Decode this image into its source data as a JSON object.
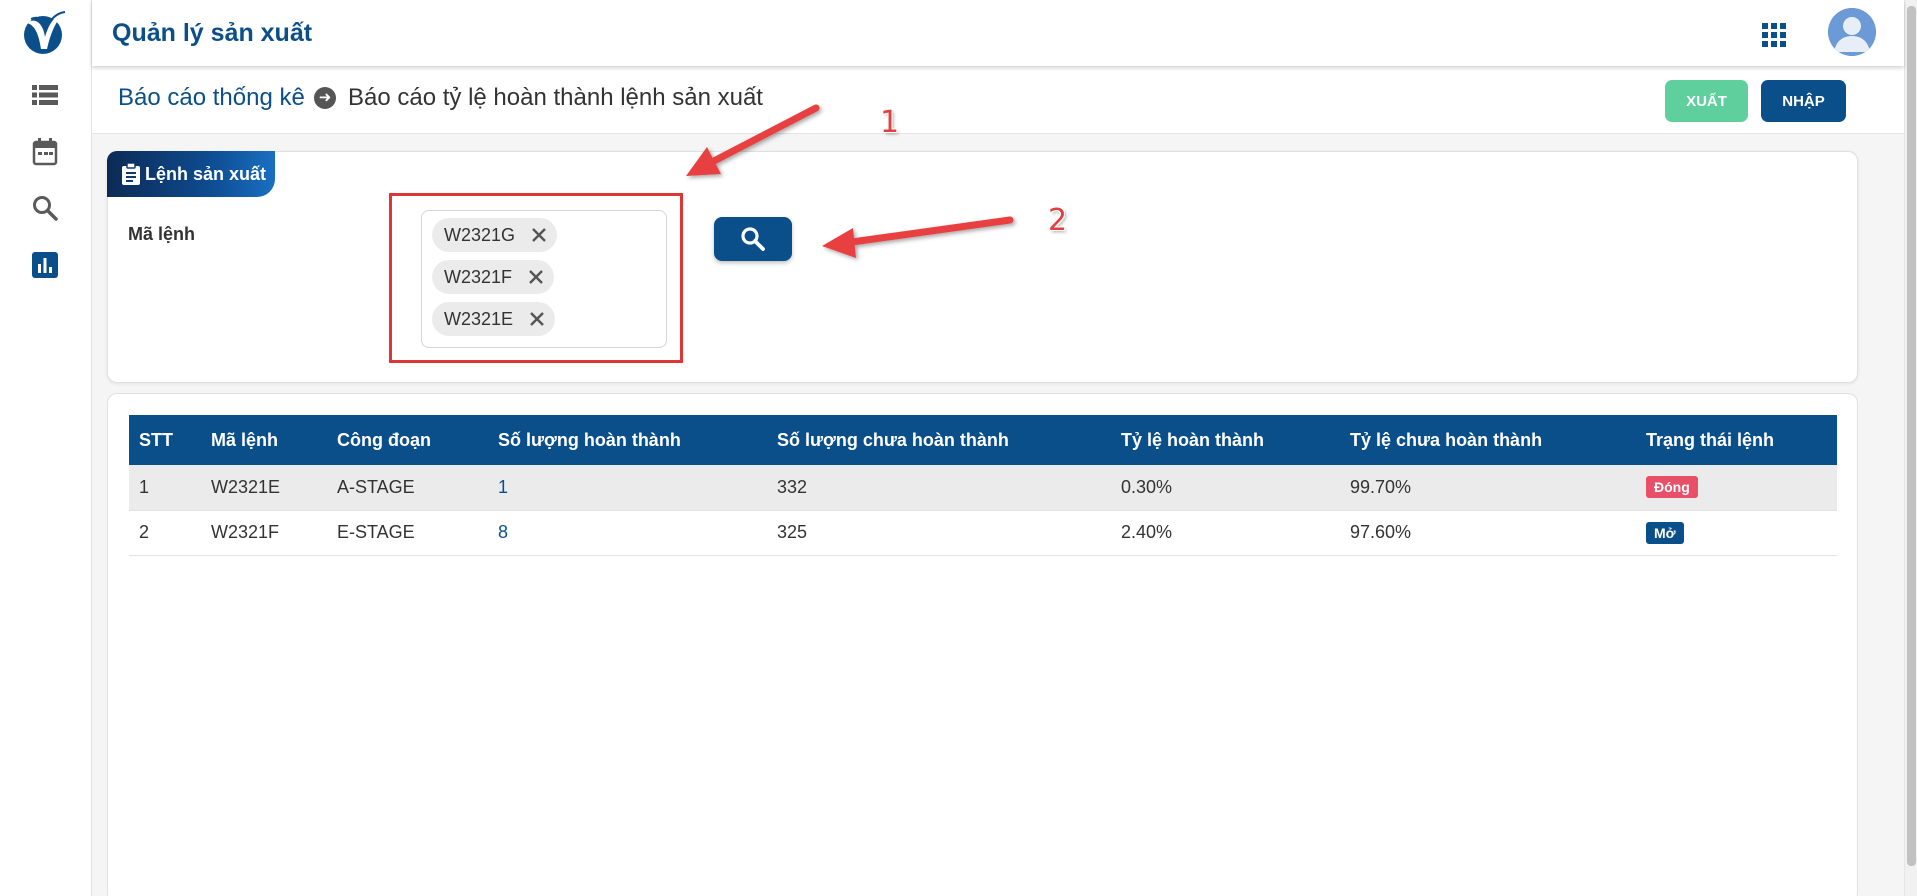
{
  "app": {
    "title": "Quản lý sản xuất"
  },
  "sidebar": {
    "items": [
      {
        "icon": "list-icon"
      },
      {
        "icon": "calendar-icon"
      },
      {
        "icon": "search-icon"
      },
      {
        "icon": "bar-chart-icon",
        "active": true
      }
    ]
  },
  "breadcrumb": {
    "root": "Báo cáo thống kê",
    "current": "Báo cáo tỷ lệ hoàn thành lệnh sản xuất"
  },
  "actions": {
    "export_label": "XUẤT",
    "import_label": "NHẬP"
  },
  "filter": {
    "tab_title": "Lệnh sản xuất",
    "field_label": "Mã lệnh",
    "selected_tags": [
      "W2321G",
      "W2321F",
      "W2321E"
    ]
  },
  "table": {
    "headers": [
      "STT",
      "Mã lệnh",
      "Công đoạn",
      "Số lượng hoàn thành",
      "Số lượng chưa hoàn thành",
      "Tỷ lệ hoàn thành",
      "Tỷ lệ chưa hoàn thành",
      "Trạng thái lệnh"
    ],
    "rows": [
      {
        "stt": "1",
        "code": "W2321E",
        "stage": "A-STAGE",
        "done": "1",
        "not_done": "332",
        "rate_done": "0.30%",
        "rate_not_done": "99.70%",
        "status": "Đóng",
        "status_color": "#e8506a"
      },
      {
        "stt": "2",
        "code": "W2321F",
        "stage": "E-STAGE",
        "done": "8",
        "not_done": "325",
        "rate_done": "2.40%",
        "rate_not_done": "97.60%",
        "status": "Mở",
        "status_color": "#0b4f8a"
      }
    ]
  },
  "annotations": {
    "label_1": "1",
    "label_2": "2",
    "color": "#e84040"
  },
  "colors": {
    "primary": "#0b4f8a",
    "export_button": "#5fcf9e",
    "status_closed": "#e8506a"
  }
}
